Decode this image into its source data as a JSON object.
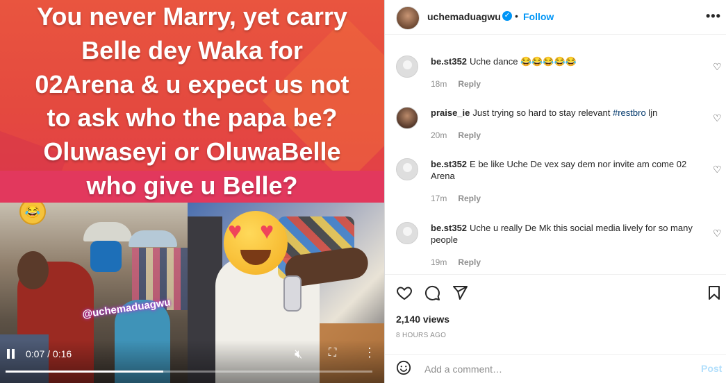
{
  "post": {
    "banner_lines": [
      "You never Marry, yet carry",
      "Belle dey Waka for",
      "02Arena & u expect us not",
      "to ask who the papa be?",
      "Oluwaseyi or OluwaBelle",
      "who give u Belle?"
    ],
    "watermark": "@uchemaduagwu",
    "video": {
      "time": "0:07 / 0:16",
      "progress_fraction": 0.43
    }
  },
  "header": {
    "username": "uchemaduagwu",
    "separator": "•",
    "follow_label": "Follow",
    "more_icon": "ellipsis-horizontal-icon"
  },
  "comments": [
    {
      "user": "be.st352",
      "text": "Uche dance 😂😂😂😂😂",
      "hashtag": "",
      "time": "18m",
      "reply": "Reply",
      "avatar": "default"
    },
    {
      "user": "praise_ie",
      "text": "Just trying so hard to stay relevant ",
      "hashtag": "#restbro",
      "text_after": " ljn",
      "time": "20m",
      "reply": "Reply",
      "avatar": "photo"
    },
    {
      "user": "be.st352",
      "text": "E be like Uche De vex say dem nor invite am come 02 Arena",
      "hashtag": "",
      "time": "17m",
      "reply": "Reply",
      "avatar": "default"
    },
    {
      "user": "be.st352",
      "text": "Uche u really De Mk this social media lively for so many people",
      "hashtag": "",
      "time": "19m",
      "reply": "Reply",
      "avatar": "default"
    }
  ],
  "stats": {
    "views": "2,140 views",
    "posted": "8 HOURS AGO"
  },
  "composer": {
    "placeholder": "Add a comment…",
    "post_label": "Post"
  },
  "colors": {
    "accent": "#0095f6",
    "post_disabled": "#b2dffc",
    "muted": "#8e8e8e"
  }
}
